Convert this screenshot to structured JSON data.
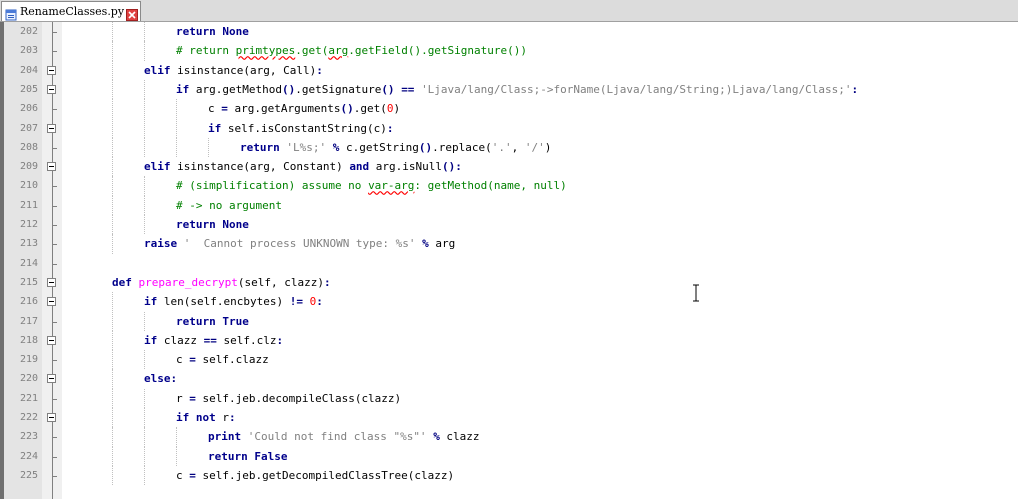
{
  "tab": {
    "file_name": "RenameClasses.py"
  },
  "icons": {
    "file": "document-icon",
    "close": "close-icon"
  },
  "colors": {
    "keyword": "#00008b",
    "function_def": "#ff00ff",
    "number": "#ff0000",
    "string": "#808080",
    "comment": "#008000"
  },
  "lines": [
    {
      "number": "202",
      "indent": 3,
      "tokens": [
        [
          "kw",
          "return"
        ],
        [
          "t",
          " "
        ],
        [
          "kw",
          "None"
        ]
      ]
    },
    {
      "number": "203",
      "indent": 3,
      "tokens": [
        [
          "cmt",
          "# return "
        ],
        [
          "cmtsq",
          "primtypes"
        ],
        [
          "cmt",
          ".get("
        ],
        [
          "cmtsq",
          "arg"
        ],
        [
          "cmt",
          ".getField().getSignature())"
        ]
      ]
    },
    {
      "number": "204",
      "indent": 2,
      "tokens": [
        [
          "kw",
          "elif"
        ],
        [
          "t",
          " isinstance(arg, Call)"
        ],
        [
          "op",
          ":"
        ]
      ]
    },
    {
      "number": "205",
      "indent": 3,
      "tokens": [
        [
          "kw",
          "if"
        ],
        [
          "t",
          " arg.getMethod"
        ],
        [
          "op",
          "()"
        ],
        [
          "t",
          ".getSignature"
        ],
        [
          "op",
          "()"
        ],
        [
          "t",
          " "
        ],
        [
          "op",
          "=="
        ],
        [
          "t",
          " "
        ],
        [
          "str",
          "'Ljava/lang/Class;->forName(Ljava/lang/String;)Ljava/lang/Class;'"
        ],
        [
          "op",
          ":"
        ]
      ]
    },
    {
      "number": "206",
      "indent": 4,
      "tokens": [
        [
          "t",
          "c "
        ],
        [
          "op",
          "="
        ],
        [
          "t",
          " arg.getArguments"
        ],
        [
          "op",
          "()"
        ],
        [
          "t",
          ".get("
        ],
        [
          "num",
          "0"
        ],
        [
          "t",
          ")"
        ]
      ]
    },
    {
      "number": "207",
      "indent": 4,
      "tokens": [
        [
          "kw",
          "if"
        ],
        [
          "t",
          " self.isConstantString(c)"
        ],
        [
          "op",
          ":"
        ]
      ]
    },
    {
      "number": "208",
      "indent": 5,
      "tokens": [
        [
          "kw",
          "return"
        ],
        [
          "t",
          " "
        ],
        [
          "str",
          "'L%s;'"
        ],
        [
          "t",
          " "
        ],
        [
          "op",
          "%"
        ],
        [
          "t",
          " c.getString"
        ],
        [
          "op",
          "()"
        ],
        [
          "t",
          ".replace("
        ],
        [
          "str",
          "'.'"
        ],
        [
          "t",
          ", "
        ],
        [
          "str",
          "'/'"
        ],
        [
          "t",
          ")"
        ]
      ]
    },
    {
      "number": "209",
      "indent": 2,
      "tokens": [
        [
          "kw",
          "elif"
        ],
        [
          "t",
          " isinstance(arg, Constant) "
        ],
        [
          "kw",
          "and"
        ],
        [
          "t",
          " arg.isNull"
        ],
        [
          "op",
          "():"
        ]
      ]
    },
    {
      "number": "210",
      "indent": 3,
      "tokens": [
        [
          "cmt",
          "# (simplification) assume no "
        ],
        [
          "cmtsq",
          "var-arg"
        ],
        [
          "cmt",
          ": getMethod(name, null)"
        ]
      ]
    },
    {
      "number": "211",
      "indent": 3,
      "tokens": [
        [
          "cmt",
          "# -> no argument"
        ]
      ]
    },
    {
      "number": "212",
      "indent": 3,
      "tokens": [
        [
          "kw",
          "return"
        ],
        [
          "t",
          " "
        ],
        [
          "kw",
          "None"
        ]
      ]
    },
    {
      "number": "213",
      "indent": 2,
      "tokens": [
        [
          "kw",
          "raise"
        ],
        [
          "t",
          " "
        ],
        [
          "str",
          "'  Cannot process UNKNOWN type: %s'"
        ],
        [
          "t",
          " "
        ],
        [
          "op",
          "%"
        ],
        [
          "t",
          " arg"
        ]
      ]
    },
    {
      "number": "214",
      "indent": 0,
      "tokens": []
    },
    {
      "number": "215",
      "indent": 1,
      "tokens": [
        [
          "kw",
          "def"
        ],
        [
          "t",
          " "
        ],
        [
          "fn",
          "prepare_decrypt"
        ],
        [
          "t",
          "(self, clazz)"
        ],
        [
          "op",
          ":"
        ]
      ]
    },
    {
      "number": "216",
      "indent": 2,
      "tokens": [
        [
          "kw",
          "if"
        ],
        [
          "t",
          " len(self.encbytes) "
        ],
        [
          "op",
          "!="
        ],
        [
          "t",
          " "
        ],
        [
          "num",
          "0"
        ],
        [
          "op",
          ":"
        ]
      ]
    },
    {
      "number": "217",
      "indent": 3,
      "tokens": [
        [
          "kw",
          "return"
        ],
        [
          "t",
          " "
        ],
        [
          "kw",
          "True"
        ]
      ]
    },
    {
      "number": "218",
      "indent": 2,
      "tokens": [
        [
          "kw",
          "if"
        ],
        [
          "t",
          " clazz "
        ],
        [
          "op",
          "=="
        ],
        [
          "t",
          " self.clz"
        ],
        [
          "op",
          ":"
        ]
      ]
    },
    {
      "number": "219",
      "indent": 3,
      "tokens": [
        [
          "t",
          "c "
        ],
        [
          "op",
          "="
        ],
        [
          "t",
          " self.clazz"
        ]
      ]
    },
    {
      "number": "220",
      "indent": 2,
      "tokens": [
        [
          "kw",
          "else"
        ],
        [
          "op",
          ":"
        ]
      ]
    },
    {
      "number": "221",
      "indent": 3,
      "tokens": [
        [
          "t",
          "r "
        ],
        [
          "op",
          "="
        ],
        [
          "t",
          " self.jeb.decompileClass(clazz)"
        ]
      ]
    },
    {
      "number": "222",
      "indent": 3,
      "tokens": [
        [
          "kw",
          "if"
        ],
        [
          "t",
          " "
        ],
        [
          "kw",
          "not"
        ],
        [
          "t",
          " r"
        ],
        [
          "op",
          ":"
        ]
      ]
    },
    {
      "number": "223",
      "indent": 4,
      "tokens": [
        [
          "kw",
          "print"
        ],
        [
          "t",
          " "
        ],
        [
          "str",
          "'Could not find class \"%s\"'"
        ],
        [
          "t",
          " "
        ],
        [
          "op",
          "%"
        ],
        [
          "t",
          " clazz"
        ]
      ]
    },
    {
      "number": "224",
      "indent": 4,
      "tokens": [
        [
          "kw",
          "return"
        ],
        [
          "t",
          " "
        ],
        [
          "kw",
          "False"
        ]
      ]
    },
    {
      "number": "225",
      "indent": 3,
      "tokens": [
        [
          "t",
          "c "
        ],
        [
          "op",
          "="
        ],
        [
          "t",
          " self.jeb.getDecompiledClassTree(clazz)"
        ]
      ]
    }
  ]
}
